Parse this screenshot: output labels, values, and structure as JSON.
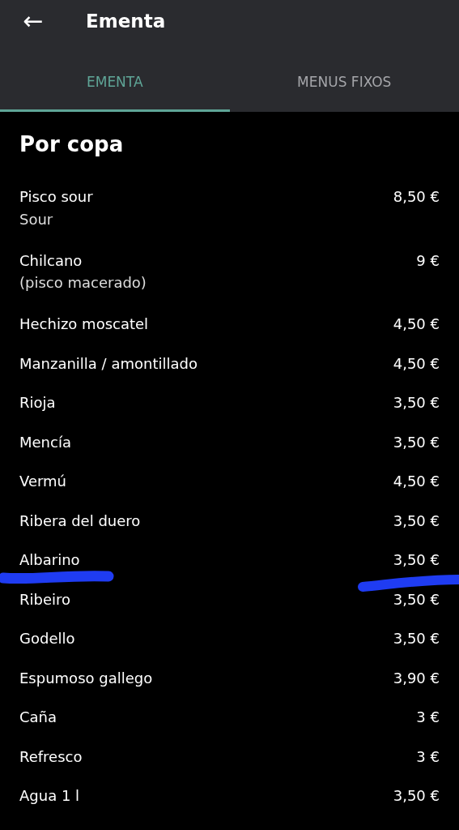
{
  "app_bar": {
    "back": "←",
    "title": "Ementa"
  },
  "tabs": [
    {
      "label": "EMENTA",
      "selected": true
    },
    {
      "label": "MENUS FIXOS",
      "selected": false
    }
  ],
  "section": {
    "title": "Por copa",
    "items": [
      {
        "name": "Pisco sour",
        "description": "Sour",
        "price": "8,50 €",
        "marked": false
      },
      {
        "name": "Chilcano",
        "description": "(pisco macerado)",
        "price": "9 €",
        "marked": false
      },
      {
        "name": "Hechizo moscatel",
        "price": "4,50 €",
        "marked": false
      },
      {
        "name": "Manzanilla / amontillado",
        "price": "4,50 €",
        "marked": false
      },
      {
        "name": "Rioja",
        "price": "3,50 €",
        "marked": false
      },
      {
        "name": "Mencía",
        "price": "3,50 €",
        "marked": false
      },
      {
        "name": "Vermú",
        "price": "4,50 €",
        "marked": false
      },
      {
        "name": "Ribera del duero",
        "price": "3,50 €",
        "marked": false
      },
      {
        "name": "Albarino",
        "price": "3,50 €",
        "marked": true
      },
      {
        "name": "Ribeiro",
        "price": "3,50 €",
        "marked": false
      },
      {
        "name": "Godello",
        "price": "3,50 €",
        "marked": false
      },
      {
        "name": "Espumoso gallego",
        "price": "3,90 €",
        "marked": false
      },
      {
        "name": "Caña",
        "price": "3 €",
        "marked": false
      },
      {
        "name": "Refresco",
        "price": "3 €",
        "marked": false
      },
      {
        "name": "Agua 1 l",
        "price": "3,50 €",
        "marked": false
      }
    ]
  }
}
